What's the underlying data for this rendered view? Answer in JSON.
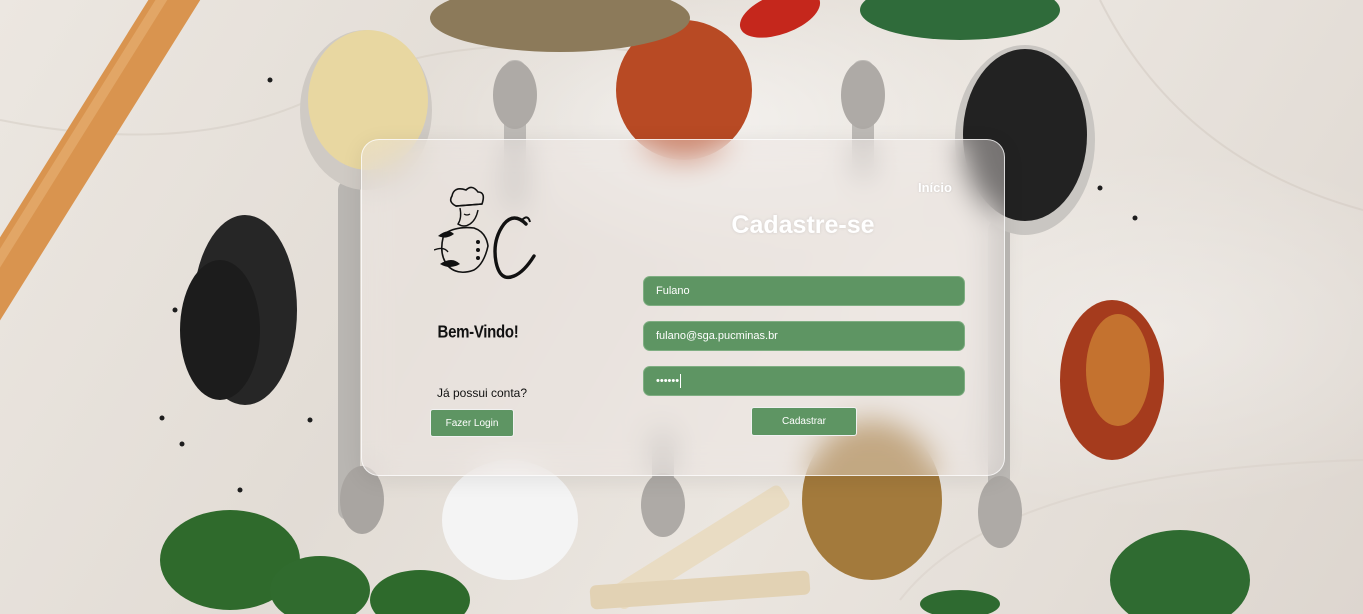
{
  "nav": {
    "home_label": "Início"
  },
  "welcome": {
    "logo_icon": "chef-logo-icon",
    "title": "Bem-Vindo!",
    "has_account_text": "Já possui conta?",
    "login_button_label": "Fazer Login"
  },
  "signup_form": {
    "title": "Cadastre-se",
    "name_value": "Fulano",
    "email_value": "fulano@sga.pucminas.br",
    "password_value": "••••••",
    "submit_label": "Cadastrar"
  },
  "colors": {
    "accent_green": "#5e9563",
    "text_light": "#ffffff"
  }
}
